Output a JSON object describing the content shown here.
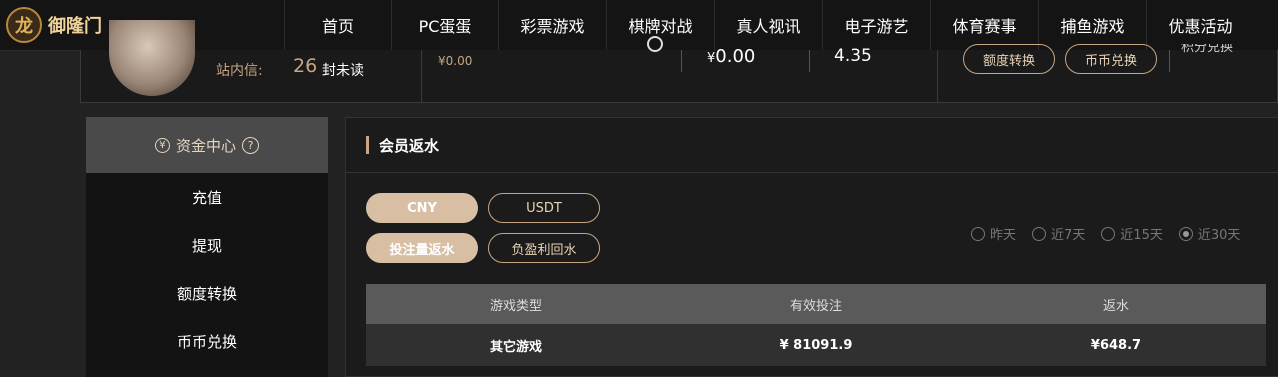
{
  "brand": {
    "logo_text": "御隆门"
  },
  "nav": [
    "首页",
    "PC蛋蛋",
    "彩票游戏",
    "棋牌对战",
    "真人视讯",
    "电子游艺",
    "体育赛事",
    "捕鱼游戏",
    "优惠活动"
  ],
  "summary": {
    "mail_label": "站内信:",
    "mail_count": "26",
    "mail_unit": "封未读",
    "balance_a": "¥0.00",
    "balance_b": "0.00",
    "balance_b_symbol": "¥",
    "value_c": "4.35",
    "transfer_button": "额度转换",
    "coin_button": "币币兑换",
    "points_label": "积分兑换"
  },
  "sidebar": {
    "header": "资金中心",
    "header_icon": "yuan-icon",
    "help_icon": "help-icon",
    "items": [
      "充值",
      "提现",
      "额度转换",
      "币币兑换"
    ]
  },
  "panel": {
    "title": "会员返水",
    "currency_buttons": [
      "CNY",
      "USDT"
    ],
    "type_buttons": [
      "投注量返水",
      "负盈利回水"
    ],
    "ranges": [
      "昨天",
      "近7天",
      "近15天",
      "近30天"
    ],
    "selected_range": "近30天",
    "table": {
      "headers": [
        "游戏类型",
        "有效投注",
        "返水"
      ],
      "rows": [
        [
          "其它游戏",
          "¥ 81091.9",
          "¥648.7"
        ]
      ]
    }
  },
  "colors": {
    "accent": "#c8a684",
    "active_button": "#d8bfa3",
    "background": "#222222"
  }
}
